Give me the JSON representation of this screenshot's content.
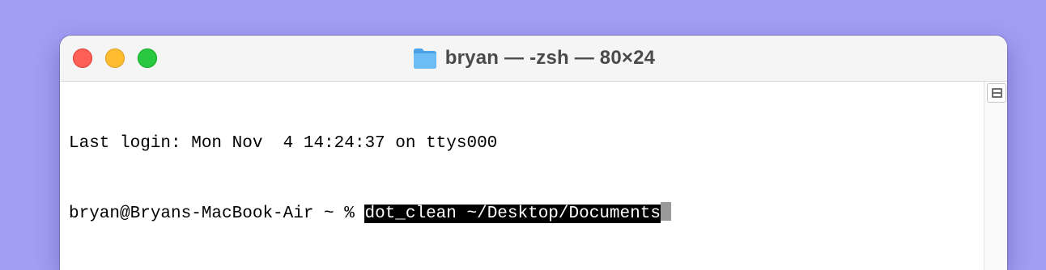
{
  "window": {
    "title": "bryan — -zsh — 80×24",
    "title_icon": "folder-icon",
    "traffic_lights": {
      "close_color": "#fe5f57",
      "minimize_color": "#febc2e",
      "maximize_color": "#28c840"
    }
  },
  "terminal": {
    "login_line": "Last login: Mon Nov  4 14:24:37 on ttys000",
    "prompt": "bryan@Bryans-MacBook-Air ~ % ",
    "command": "dot_clean ~/Desktop/Documents"
  },
  "scrollbar": {
    "split_icon": "split-pane-icon"
  },
  "colors": {
    "desktop_background": "#a29ef5",
    "selection_background": "#000000",
    "cursor": "#9a9a9a"
  }
}
